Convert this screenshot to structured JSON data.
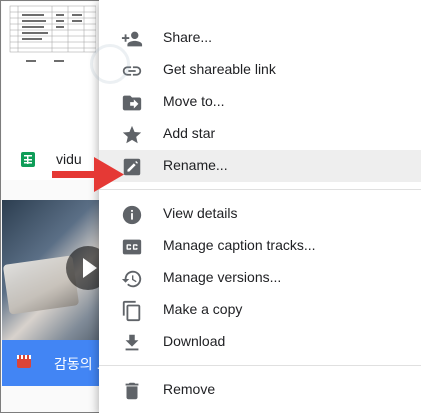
{
  "files": {
    "sheet_name": "vidu",
    "video_name": "감동의 ..."
  },
  "menu": {
    "items": [
      {
        "label": "Share...",
        "icon": "person-add-icon"
      },
      {
        "label": "Get shareable link",
        "icon": "link-icon"
      },
      {
        "label": "Move to...",
        "icon": "folder-move-icon"
      },
      {
        "label": "Add star",
        "icon": "star-icon"
      },
      {
        "label": "Rename...",
        "icon": "pencil-icon"
      },
      {
        "label": "View details",
        "icon": "info-icon"
      },
      {
        "label": "Manage caption tracks...",
        "icon": "closed-caption-icon"
      },
      {
        "label": "Manage versions...",
        "icon": "history-icon"
      },
      {
        "label": "Make a copy",
        "icon": "copy-icon"
      },
      {
        "label": "Download",
        "icon": "download-icon"
      },
      {
        "label": "Remove",
        "icon": "trash-icon"
      }
    ],
    "highlighted": "Rename..."
  },
  "colors": {
    "highlight": "#eeeeee",
    "icon": "#5f6368",
    "arrow": "#e53935",
    "sheets_green": "#0f9d58",
    "video_bar": "#4285f4"
  }
}
